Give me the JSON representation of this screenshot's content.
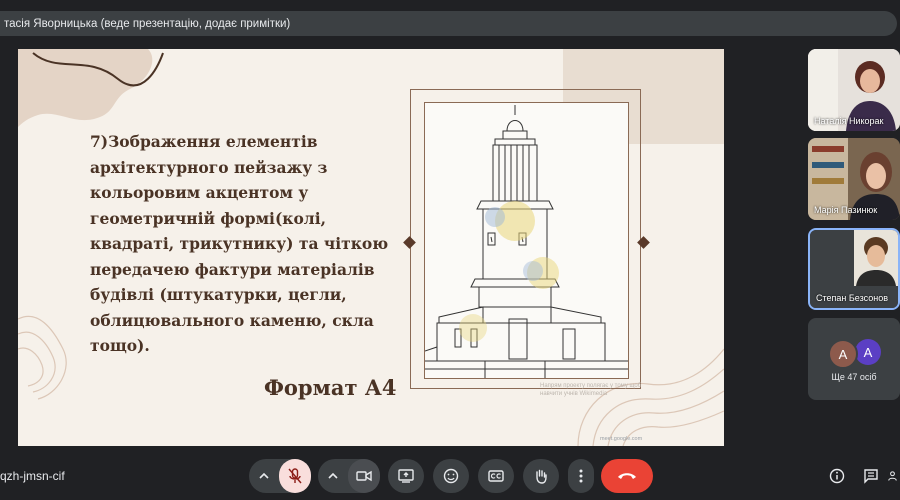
{
  "presenter_bar": {
    "text": "тасія Яворницька (веде презентацію, додає примітки)"
  },
  "slide": {
    "body_text": "7)Зображення елементів архітектурного пейзажу з кольоровим акцентом у геометричній формі(колі, квадраті, трикутнику) та чіткою передачею фактури матеріалів будівлі (штукатурки, цегли, облицювального каменю, скла тощо).",
    "format_label": "Формат А4",
    "watermark_text": "Напрям проекту полягає у тому щоб навчити учнів Wikimedia",
    "url_tag": "meet.google.com"
  },
  "participants": [
    {
      "name": "Наталія Никорак"
    },
    {
      "name": "Марія Пазинюк"
    },
    {
      "name": "Степан Безсонов",
      "active_speaker": true
    }
  ],
  "more_participants": {
    "avatars": [
      "A",
      "A"
    ],
    "avatar_colors": [
      "#8d5a4c",
      "#5b3fc4"
    ],
    "label": "Ще 47 осіб"
  },
  "meeting": {
    "code": "qzh-jmsn-cif"
  },
  "controls": {
    "mic_muted_color": "#f9dedc",
    "end_call_color": "#ea4335",
    "icons": [
      "chevron-up-icon",
      "mic-off-icon",
      "chevron-up-icon",
      "camera-icon",
      "present-icon",
      "emoji-icon",
      "captions-icon",
      "raise-hand-icon",
      "more-vert-icon",
      "end-call-icon",
      "info-icon",
      "chat-icon",
      "people-icon"
    ]
  }
}
